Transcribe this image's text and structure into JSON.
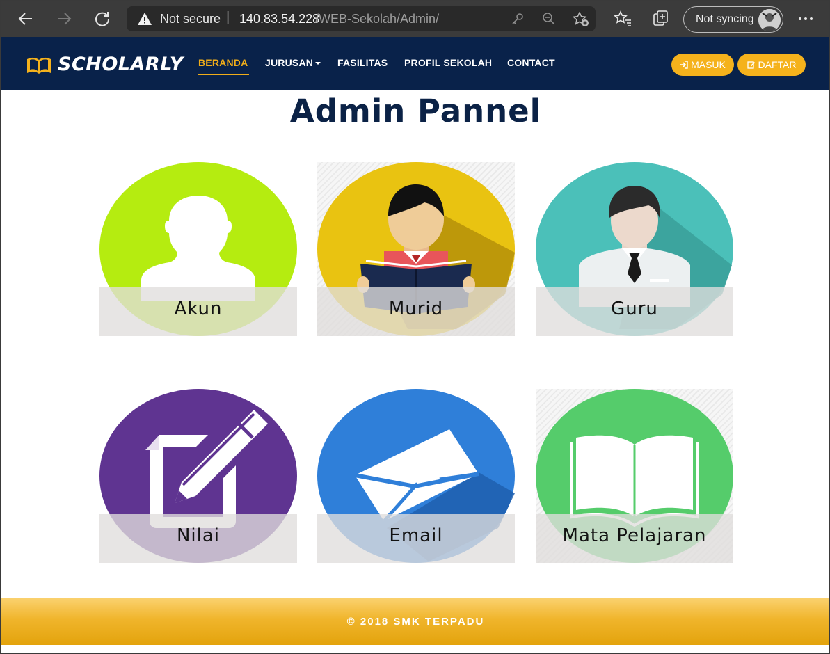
{
  "browser": {
    "security_label": "Not secure",
    "url_host": "140.83.54.228",
    "url_path": "/WEB-Sekolah/Admin/",
    "sync_label": "Not syncing"
  },
  "navbar": {
    "brand": "SCHOLARLY",
    "links": [
      "BERANDA",
      "JURUSAN",
      "FASILITAS",
      "PROFIL SEKOLAH",
      "CONTACT"
    ],
    "active_link": "BERANDA",
    "login_label": "MASUK",
    "register_label": "DAFTAR",
    "colors": {
      "background": "#09224a",
      "accent": "#f0ad1a",
      "button": "#f5b21c"
    }
  },
  "main": {
    "title": "Admin Pannel",
    "tiles": [
      {
        "label": "Akun",
        "icon": "user-silhouette-icon",
        "color": "#b5ec10"
      },
      {
        "label": "Murid",
        "icon": "student-reading-icon",
        "color": "#e9c311"
      },
      {
        "label": "Guru",
        "icon": "teacher-icon",
        "color": "#4bc0b9"
      },
      {
        "label": "Nilai",
        "icon": "document-pencil-icon",
        "color": "#5f3491"
      },
      {
        "label": "Email",
        "icon": "envelope-icon",
        "color": "#2f7fd9"
      },
      {
        "label": "Mata Pelajaran",
        "icon": "open-book-icon",
        "color": "#55cc6b"
      }
    ]
  },
  "footer": {
    "text": "© 2018 SMK TERPADU"
  }
}
